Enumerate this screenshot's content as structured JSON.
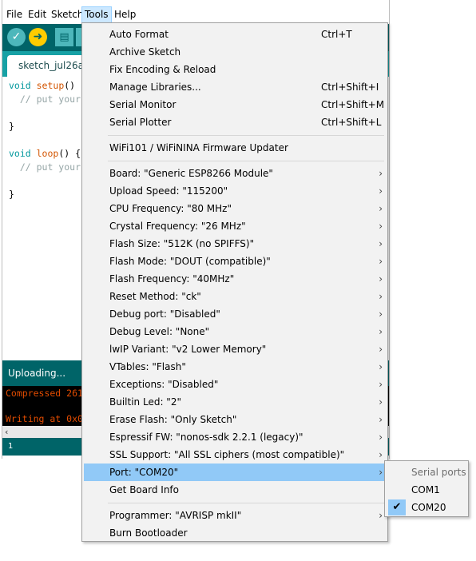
{
  "menubar": {
    "items": [
      "File",
      "Edit",
      "Sketch",
      "Tools",
      "Help"
    ]
  },
  "toolbar": {
    "verify_icon": "checkmark-icon",
    "upload_icon": "arrow-right-icon",
    "new_icon": "new-file-icon"
  },
  "tab": {
    "label": "sketch_jul26a"
  },
  "editor": {
    "lines": [
      {
        "kw": "void ",
        "fn": "setup",
        "rest": "() {"
      },
      {
        "cm": "  // put your"
      },
      {
        "rest": ""
      },
      {
        "rest": "}"
      },
      {
        "rest": ""
      },
      {
        "kw": "void ",
        "fn": "loop",
        "rest": "() {"
      },
      {
        "cm": "  // put your"
      },
      {
        "rest": ""
      },
      {
        "rest": "}"
      }
    ]
  },
  "status": {
    "text": "Uploading..."
  },
  "console": {
    "lines": [
      "Compressed 261",
      "",
      "Writing at 0x0"
    ]
  },
  "footer": {
    "line": "1"
  },
  "tools_menu": {
    "items": [
      {
        "label": "Auto Format",
        "shortcut": "Ctrl+T"
      },
      {
        "label": "Archive Sketch"
      },
      {
        "label": "Fix Encoding & Reload"
      },
      {
        "label": "Manage Libraries...",
        "shortcut": "Ctrl+Shift+I"
      },
      {
        "label": "Serial Monitor",
        "shortcut": "Ctrl+Shift+M"
      },
      {
        "label": "Serial Plotter",
        "shortcut": "Ctrl+Shift+L"
      },
      {
        "sep": true
      },
      {
        "label": "WiFi101 / WiFiNINA Firmware Updater"
      },
      {
        "sep": true
      },
      {
        "label": "Board: \"Generic ESP8266 Module\"",
        "arrow": true
      },
      {
        "label": "Upload Speed: \"115200\"",
        "arrow": true
      },
      {
        "label": "CPU Frequency: \"80 MHz\"",
        "arrow": true
      },
      {
        "label": "Crystal Frequency: \"26 MHz\"",
        "arrow": true
      },
      {
        "label": "Flash Size: \"512K (no SPIFFS)\"",
        "arrow": true
      },
      {
        "label": "Flash Mode: \"DOUT (compatible)\"",
        "arrow": true
      },
      {
        "label": "Flash Frequency: \"40MHz\"",
        "arrow": true
      },
      {
        "label": "Reset Method: \"ck\"",
        "arrow": true
      },
      {
        "label": "Debug port: \"Disabled\"",
        "arrow": true
      },
      {
        "label": "Debug Level: \"None\"",
        "arrow": true
      },
      {
        "label": "lwIP Variant: \"v2 Lower Memory\"",
        "arrow": true
      },
      {
        "label": "VTables: \"Flash\"",
        "arrow": true
      },
      {
        "label": "Exceptions: \"Disabled\"",
        "arrow": true
      },
      {
        "label": "Builtin Led: \"2\"",
        "arrow": true
      },
      {
        "label": "Erase Flash: \"Only Sketch\"",
        "arrow": true
      },
      {
        "label": "Espressif FW: \"nonos-sdk 2.2.1 (legacy)\"",
        "arrow": true
      },
      {
        "label": "SSL Support: \"All SSL ciphers (most compatible)\"",
        "arrow": true
      },
      {
        "label": "Port: \"COM20\"",
        "arrow": true,
        "selected": true
      },
      {
        "label": "Get Board Info"
      },
      {
        "sep": true
      },
      {
        "label": "Programmer: \"AVRISP mkII\"",
        "arrow": true
      },
      {
        "label": "Burn Bootloader"
      }
    ],
    "arrow_glyph": "›"
  },
  "port_submenu": {
    "header": "Serial ports",
    "items": [
      {
        "label": "COM1",
        "checked": false
      },
      {
        "label": "COM20",
        "checked": true
      }
    ],
    "check_glyph": "✔"
  },
  "colors": {
    "toolbar": "#006468",
    "tabs": "#17a1a5",
    "menu_bg": "#f2f2f2",
    "selected": "#91c9f7",
    "console_text": "#e34c00"
  }
}
